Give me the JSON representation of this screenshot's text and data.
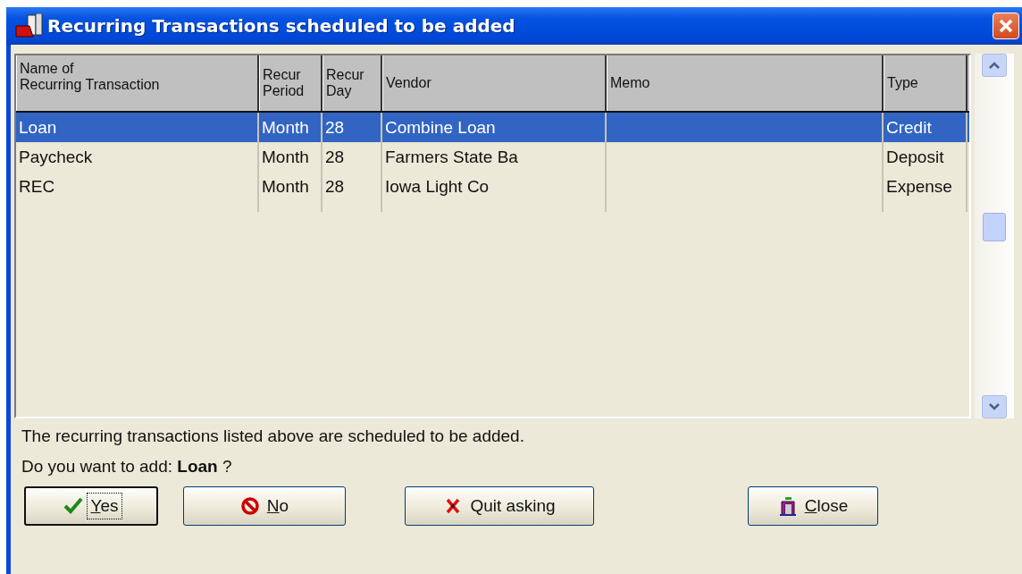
{
  "window": {
    "title": "Recurring Transactions scheduled to be added"
  },
  "table": {
    "columns": [
      {
        "label": "Name of\nRecurring Transaction"
      },
      {
        "label": "Recur\nPeriod"
      },
      {
        "label": "Recur\nDay"
      },
      {
        "label": "Vendor"
      },
      {
        "label": "Memo"
      },
      {
        "label": "Type"
      }
    ],
    "rows": [
      {
        "selected": true,
        "cells": [
          "Loan",
          "Month",
          "28",
          "Combine Loan",
          "",
          "Credit"
        ]
      },
      {
        "selected": false,
        "cells": [
          "Paycheck",
          "Month",
          "28",
          "Farmers State Ba",
          "",
          "Deposit"
        ]
      },
      {
        "selected": false,
        "cells": [
          "REC",
          "Month",
          "28",
          "Iowa Light Co",
          "",
          "Expense"
        ]
      }
    ]
  },
  "message": "The recurring transactions listed above are scheduled to be added.",
  "prompt": "Do you want to add:  **Loan** ?",
  "buttons": [
    {
      "kind": "yes",
      "key": "Y",
      "rest": "es",
      "focused": true
    },
    {
      "kind": "no",
      "key": "N",
      "rest": "o",
      "focused": false
    },
    {
      "kind": "quit",
      "rest": "Quit asking",
      "focused": false
    },
    {
      "kind": "close",
      "key": "C",
      "rest": "lose",
      "focused": false
    }
  ]
}
